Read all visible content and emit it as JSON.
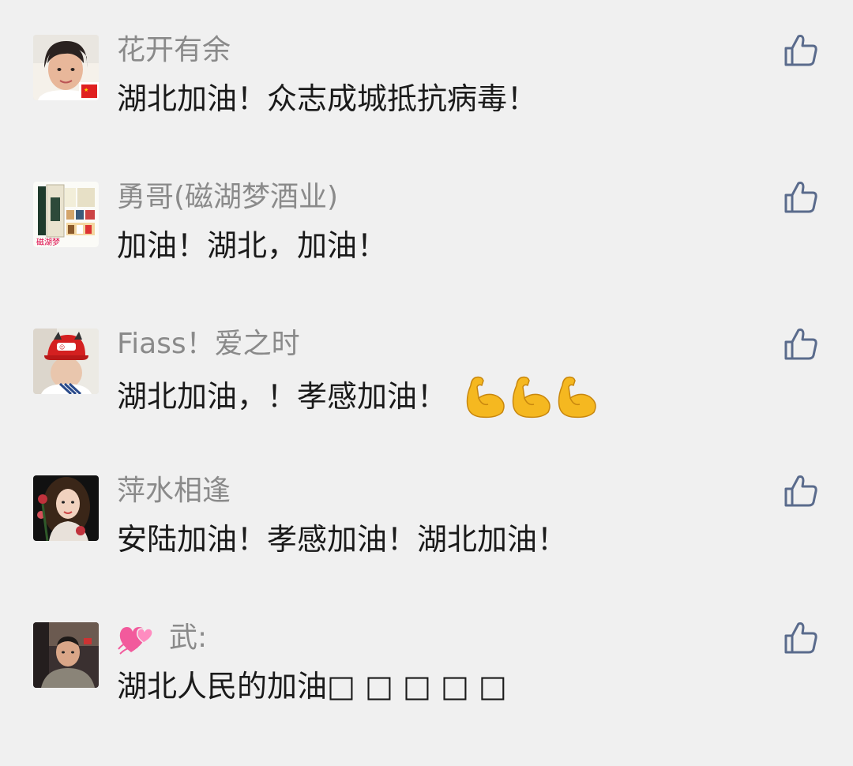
{
  "comments": [
    {
      "nickname": "花开有余",
      "text": "湖北加油！众志成城抵抗病毒！",
      "avatar_icon": "avatar-woman-flag",
      "like_icon": "thumbs-up-icon"
    },
    {
      "nickname": "勇哥(磁湖梦酒业)",
      "text": "加油！湖北，加油！",
      "avatar_icon": "avatar-liquor-product",
      "avatar_caption": "磁湖梦",
      "like_icon": "thumbs-up-icon"
    },
    {
      "nickname": "Fiass！爱之时",
      "text": "湖北加油，！孝感加油！",
      "avatar_icon": "avatar-man-red-cap",
      "emoji_icon": "flexed-biceps-emoji",
      "emoji_count": 3,
      "like_icon": "thumbs-up-icon"
    },
    {
      "nickname": "萍水相逢",
      "text": "安陆加油！孝感加油！湖北加油！",
      "avatar_icon": "avatar-woman-roses",
      "like_icon": "thumbs-up-icon"
    },
    {
      "nickname": "武:",
      "nickname_emoji_icon": "two-hearts-emoji",
      "text": "湖北人民的加油□ □ □ □ □",
      "avatar_icon": "avatar-man-car",
      "like_icon": "thumbs-up-icon"
    }
  ],
  "colors": {
    "background": "#f0f0f0",
    "nickname": "#8a8a8a",
    "text": "#1a1a1a",
    "like_icon": "#5a6b8c",
    "biceps": "#f5b820",
    "hearts": "#f25a9c"
  }
}
